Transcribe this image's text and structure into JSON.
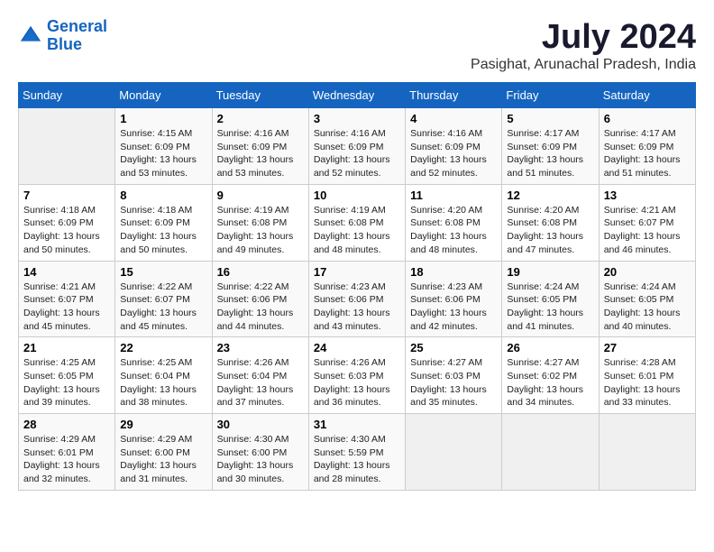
{
  "logo": {
    "line1": "General",
    "line2": "Blue"
  },
  "title": "July 2024",
  "location": "Pasighat, Arunachal Pradesh, India",
  "weekdays": [
    "Sunday",
    "Monday",
    "Tuesday",
    "Wednesday",
    "Thursday",
    "Friday",
    "Saturday"
  ],
  "weeks": [
    [
      {
        "day": "",
        "sunrise": "",
        "sunset": "",
        "daylight": ""
      },
      {
        "day": "1",
        "sunrise": "Sunrise: 4:15 AM",
        "sunset": "Sunset: 6:09 PM",
        "daylight": "Daylight: 13 hours and 53 minutes."
      },
      {
        "day": "2",
        "sunrise": "Sunrise: 4:16 AM",
        "sunset": "Sunset: 6:09 PM",
        "daylight": "Daylight: 13 hours and 53 minutes."
      },
      {
        "day": "3",
        "sunrise": "Sunrise: 4:16 AM",
        "sunset": "Sunset: 6:09 PM",
        "daylight": "Daylight: 13 hours and 52 minutes."
      },
      {
        "day": "4",
        "sunrise": "Sunrise: 4:16 AM",
        "sunset": "Sunset: 6:09 PM",
        "daylight": "Daylight: 13 hours and 52 minutes."
      },
      {
        "day": "5",
        "sunrise": "Sunrise: 4:17 AM",
        "sunset": "Sunset: 6:09 PM",
        "daylight": "Daylight: 13 hours and 51 minutes."
      },
      {
        "day": "6",
        "sunrise": "Sunrise: 4:17 AM",
        "sunset": "Sunset: 6:09 PM",
        "daylight": "Daylight: 13 hours and 51 minutes."
      }
    ],
    [
      {
        "day": "7",
        "sunrise": "Sunrise: 4:18 AM",
        "sunset": "Sunset: 6:09 PM",
        "daylight": "Daylight: 13 hours and 50 minutes."
      },
      {
        "day": "8",
        "sunrise": "Sunrise: 4:18 AM",
        "sunset": "Sunset: 6:09 PM",
        "daylight": "Daylight: 13 hours and 50 minutes."
      },
      {
        "day": "9",
        "sunrise": "Sunrise: 4:19 AM",
        "sunset": "Sunset: 6:08 PM",
        "daylight": "Daylight: 13 hours and 49 minutes."
      },
      {
        "day": "10",
        "sunrise": "Sunrise: 4:19 AM",
        "sunset": "Sunset: 6:08 PM",
        "daylight": "Daylight: 13 hours and 48 minutes."
      },
      {
        "day": "11",
        "sunrise": "Sunrise: 4:20 AM",
        "sunset": "Sunset: 6:08 PM",
        "daylight": "Daylight: 13 hours and 48 minutes."
      },
      {
        "day": "12",
        "sunrise": "Sunrise: 4:20 AM",
        "sunset": "Sunset: 6:08 PM",
        "daylight": "Daylight: 13 hours and 47 minutes."
      },
      {
        "day": "13",
        "sunrise": "Sunrise: 4:21 AM",
        "sunset": "Sunset: 6:07 PM",
        "daylight": "Daylight: 13 hours and 46 minutes."
      }
    ],
    [
      {
        "day": "14",
        "sunrise": "Sunrise: 4:21 AM",
        "sunset": "Sunset: 6:07 PM",
        "daylight": "Daylight: 13 hours and 45 minutes."
      },
      {
        "day": "15",
        "sunrise": "Sunrise: 4:22 AM",
        "sunset": "Sunset: 6:07 PM",
        "daylight": "Daylight: 13 hours and 45 minutes."
      },
      {
        "day": "16",
        "sunrise": "Sunrise: 4:22 AM",
        "sunset": "Sunset: 6:06 PM",
        "daylight": "Daylight: 13 hours and 44 minutes."
      },
      {
        "day": "17",
        "sunrise": "Sunrise: 4:23 AM",
        "sunset": "Sunset: 6:06 PM",
        "daylight": "Daylight: 13 hours and 43 minutes."
      },
      {
        "day": "18",
        "sunrise": "Sunrise: 4:23 AM",
        "sunset": "Sunset: 6:06 PM",
        "daylight": "Daylight: 13 hours and 42 minutes."
      },
      {
        "day": "19",
        "sunrise": "Sunrise: 4:24 AM",
        "sunset": "Sunset: 6:05 PM",
        "daylight": "Daylight: 13 hours and 41 minutes."
      },
      {
        "day": "20",
        "sunrise": "Sunrise: 4:24 AM",
        "sunset": "Sunset: 6:05 PM",
        "daylight": "Daylight: 13 hours and 40 minutes."
      }
    ],
    [
      {
        "day": "21",
        "sunrise": "Sunrise: 4:25 AM",
        "sunset": "Sunset: 6:05 PM",
        "daylight": "Daylight: 13 hours and 39 minutes."
      },
      {
        "day": "22",
        "sunrise": "Sunrise: 4:25 AM",
        "sunset": "Sunset: 6:04 PM",
        "daylight": "Daylight: 13 hours and 38 minutes."
      },
      {
        "day": "23",
        "sunrise": "Sunrise: 4:26 AM",
        "sunset": "Sunset: 6:04 PM",
        "daylight": "Daylight: 13 hours and 37 minutes."
      },
      {
        "day": "24",
        "sunrise": "Sunrise: 4:26 AM",
        "sunset": "Sunset: 6:03 PM",
        "daylight": "Daylight: 13 hours and 36 minutes."
      },
      {
        "day": "25",
        "sunrise": "Sunrise: 4:27 AM",
        "sunset": "Sunset: 6:03 PM",
        "daylight": "Daylight: 13 hours and 35 minutes."
      },
      {
        "day": "26",
        "sunrise": "Sunrise: 4:27 AM",
        "sunset": "Sunset: 6:02 PM",
        "daylight": "Daylight: 13 hours and 34 minutes."
      },
      {
        "day": "27",
        "sunrise": "Sunrise: 4:28 AM",
        "sunset": "Sunset: 6:01 PM",
        "daylight": "Daylight: 13 hours and 33 minutes."
      }
    ],
    [
      {
        "day": "28",
        "sunrise": "Sunrise: 4:29 AM",
        "sunset": "Sunset: 6:01 PM",
        "daylight": "Daylight: 13 hours and 32 minutes."
      },
      {
        "day": "29",
        "sunrise": "Sunrise: 4:29 AM",
        "sunset": "Sunset: 6:00 PM",
        "daylight": "Daylight: 13 hours and 31 minutes."
      },
      {
        "day": "30",
        "sunrise": "Sunrise: 4:30 AM",
        "sunset": "Sunset: 6:00 PM",
        "daylight": "Daylight: 13 hours and 30 minutes."
      },
      {
        "day": "31",
        "sunrise": "Sunrise: 4:30 AM",
        "sunset": "Sunset: 5:59 PM",
        "daylight": "Daylight: 13 hours and 28 minutes."
      },
      {
        "day": "",
        "sunrise": "",
        "sunset": "",
        "daylight": ""
      },
      {
        "day": "",
        "sunrise": "",
        "sunset": "",
        "daylight": ""
      },
      {
        "day": "",
        "sunrise": "",
        "sunset": "",
        "daylight": ""
      }
    ]
  ]
}
